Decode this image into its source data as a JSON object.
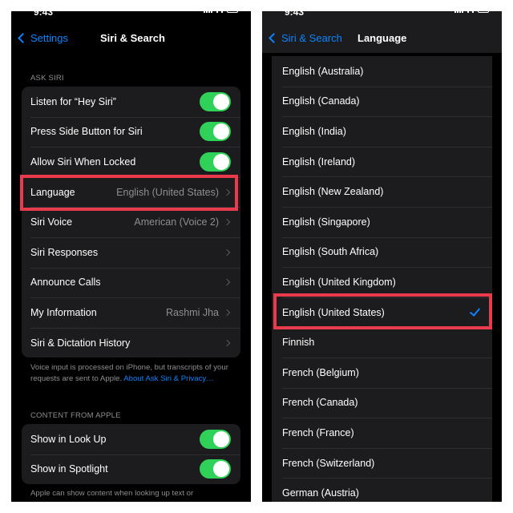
{
  "left_screen": {
    "status": {
      "time": "9:43"
    },
    "nav": {
      "back_label": "Settings",
      "title": "Siri & Search"
    },
    "ask_siri": {
      "section_label": "ASK SIRI",
      "rows": [
        {
          "label": "Listen for “Hey Siri”",
          "toggle": true
        },
        {
          "label": "Press Side Button for Siri",
          "toggle": true
        },
        {
          "label": "Allow Siri When Locked",
          "toggle": true
        },
        {
          "label": "Language",
          "value": "English (United States)",
          "highlighted": true
        },
        {
          "label": "Siri Voice",
          "value": "American (Voice 2)"
        },
        {
          "label": "Siri Responses",
          "value": ""
        },
        {
          "label": "Announce Calls",
          "value": ""
        },
        {
          "label": "My Information",
          "value": "Rashmi Jha"
        },
        {
          "label": "Siri & Dictation History",
          "value": ""
        }
      ],
      "footnote_text": "Voice input is processed on iPhone, but transcripts of your requests are sent to Apple. ",
      "footnote_link": "About Ask Siri & Privacy…"
    },
    "content_from_apple": {
      "section_label": "CONTENT FROM APPLE",
      "rows": [
        {
          "label": "Show in Look Up",
          "toggle": true
        },
        {
          "label": "Show in Spotlight",
          "toggle": true
        }
      ],
      "footnote_text": "Apple can show content when looking up text or"
    }
  },
  "right_screen": {
    "status": {
      "time": "9:43"
    },
    "nav": {
      "back_label": "Siri & Search",
      "title": "Language"
    },
    "languages": [
      {
        "label": "English (Australia)"
      },
      {
        "label": "English (Canada)"
      },
      {
        "label": "English (India)"
      },
      {
        "label": "English (Ireland)"
      },
      {
        "label": "English (New Zealand)"
      },
      {
        "label": "English (Singapore)"
      },
      {
        "label": "English (South Africa)"
      },
      {
        "label": "English (United Kingdom)"
      },
      {
        "label": "English (United States)",
        "selected": true,
        "highlighted": true
      },
      {
        "label": "Finnish"
      },
      {
        "label": "French (Belgium)"
      },
      {
        "label": "French (Canada)"
      },
      {
        "label": "French (France)"
      },
      {
        "label": "French (Switzerland)"
      },
      {
        "label": "German (Austria)"
      }
    ]
  },
  "colors": {
    "accent_blue": "#0a84ff",
    "toggle_on": "#30d158",
    "highlight_red": "#ea3a4d",
    "cell_bg": "#1c1c1e"
  }
}
